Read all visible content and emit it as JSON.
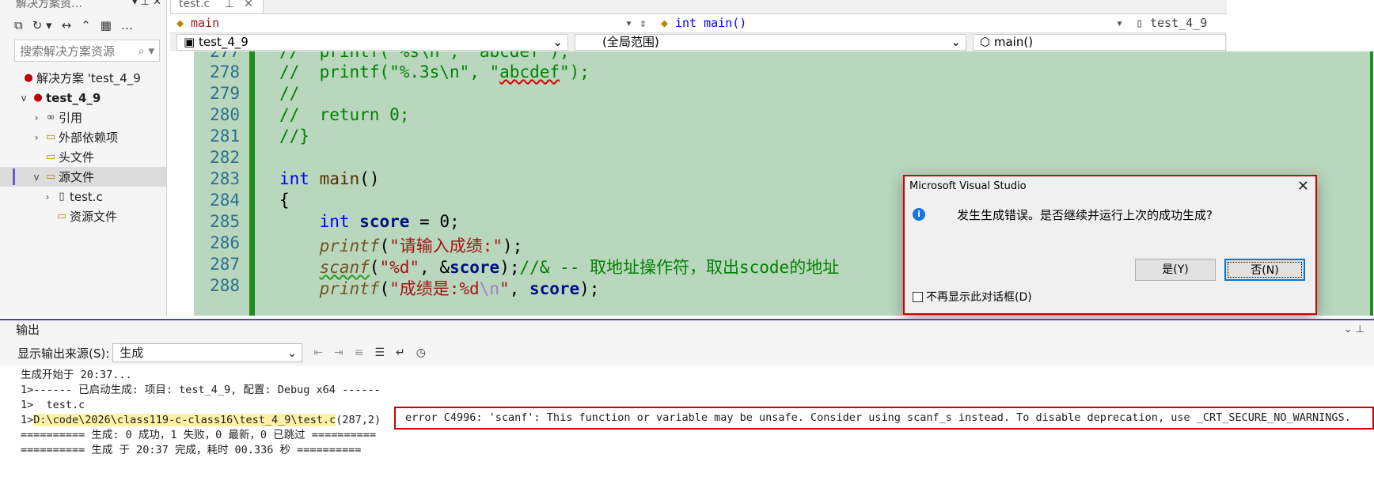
{
  "solution": {
    "title": "解决方案资…",
    "search_placeholder": "搜索解决方案资源",
    "items": [
      {
        "label": "解决方案 'test_4_9"
      },
      {
        "label": "test_4_9"
      },
      {
        "label": "引用"
      },
      {
        "label": "外部依赖项"
      },
      {
        "label": "头文件"
      },
      {
        "label": "源文件"
      },
      {
        "label": "test.c"
      },
      {
        "label": "资源文件"
      }
    ]
  },
  "editor": {
    "tab": "test.c",
    "nav_scope": "main",
    "nav_function": "int main()",
    "nav_project": "test_4_9",
    "nav2_project": "test_4_9",
    "nav2_scope": "(全局范围)",
    "nav2_function": "main()",
    "lines": [
      {
        "n": "278",
        "text": "//  printf(\"%.3s\\n\", \"abcdef\");"
      },
      {
        "n": "279",
        "text": "//"
      },
      {
        "n": "280",
        "text": "//  return 0;"
      },
      {
        "n": "281",
        "text": "//}"
      },
      {
        "n": "282",
        "text": ""
      },
      {
        "n": "283",
        "text": "int main()"
      },
      {
        "n": "284",
        "text": "{"
      },
      {
        "n": "285",
        "text": "    int score = 0;"
      },
      {
        "n": "286",
        "text": "    printf(\"请输入成绩:\");"
      },
      {
        "n": "287",
        "text": "    scanf(\"%d\", &score);//& -- 取地址操作符，取出scode的地址"
      },
      {
        "n": "288",
        "text": "    printf(\"成绩是:%d\\n\", score);"
      }
    ]
  },
  "dialog": {
    "title": "Microsoft Visual Studio",
    "message": "发生生成错误。是否继续并运行上次的成功生成?",
    "yes": "是(Y)",
    "no": "否(N)",
    "checkbox": "不再显示此对话框(D)"
  },
  "output": {
    "title": "输出",
    "source_label": "显示输出来源(S):",
    "source_value": "生成",
    "lines": [
      "生成开始于 20:37...",
      "1>------ 已启动生成: 项目: test_4_9, 配置: Debug x64 ------",
      "1>  test.c",
      "1>",
      "========== 生成: 0 成功，1 失败，0 最新，0 已跳过 ==========",
      "========== 生成 于 20:37 完成，耗时 00.336 秒 =========="
    ],
    "error_path": "D:\\code\\2026\\class119-c-class16\\test_4_9\\test.c",
    "error_pos": "(287,2)",
    "error_text": "error C4996: 'scanf': This function or variable may be unsafe. Consider using scanf_s instead. To disable deprecation, use _CRT_SECURE_NO_WARNINGS."
  }
}
